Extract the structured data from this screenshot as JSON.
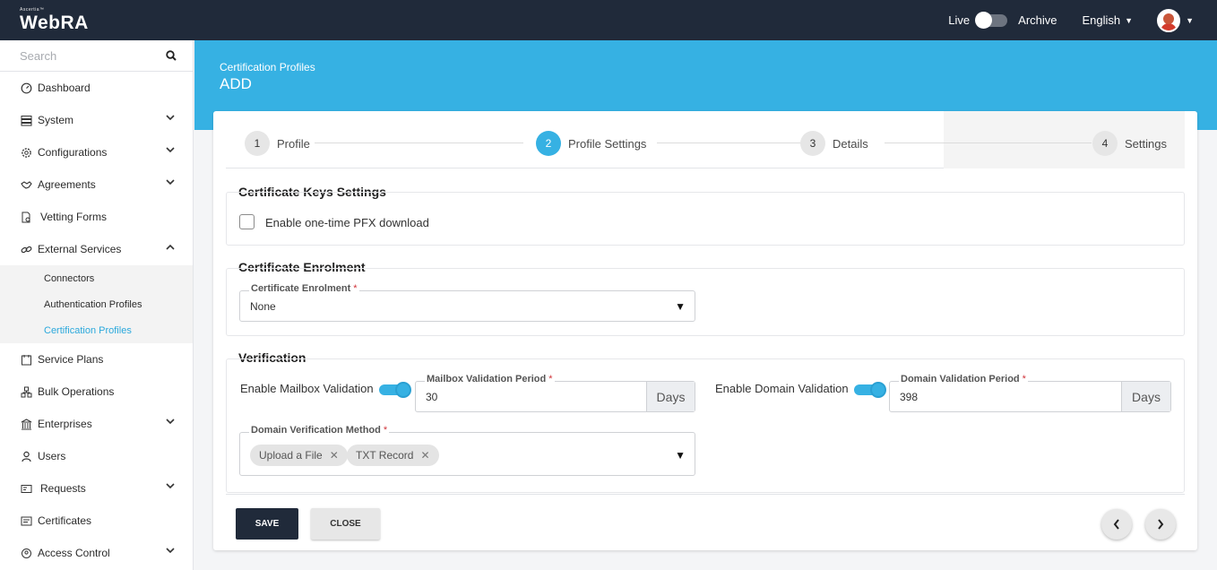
{
  "app": {
    "brand_small": "Ascertia™",
    "brand": "WebRA"
  },
  "topbar": {
    "live_label": "Live",
    "archive_label": "Archive",
    "language": "English"
  },
  "sidebar": {
    "search_placeholder": "Search",
    "items": [
      {
        "label": "Dashboard",
        "icon": "dashboard-icon",
        "expandable": false
      },
      {
        "label": "System",
        "icon": "system-icon",
        "expandable": true
      },
      {
        "label": "Configurations",
        "icon": "gear-icon",
        "expandable": true
      },
      {
        "label": "Agreements",
        "icon": "handshake-icon",
        "expandable": true
      },
      {
        "label": "Vetting Forms",
        "icon": "vetting-forms-icon",
        "expandable": false
      },
      {
        "label": "External Services",
        "icon": "link-icon",
        "expandable": true,
        "expanded": true
      },
      {
        "label": "Service Plans",
        "icon": "service-plans-icon",
        "expandable": false
      },
      {
        "label": "Bulk Operations",
        "icon": "bulk-operations-icon",
        "expandable": false
      },
      {
        "label": "Enterprises",
        "icon": "enterprise-icon",
        "expandable": true
      },
      {
        "label": "Users",
        "icon": "user-icon",
        "expandable": false
      },
      {
        "label": "Requests",
        "icon": "requests-icon",
        "expandable": true
      },
      {
        "label": "Certificates",
        "icon": "certificate-icon",
        "expandable": false
      },
      {
        "label": "Access Control",
        "icon": "access-control-icon",
        "expandable": true
      }
    ],
    "sub_items": [
      "Connectors",
      "Authentication Profiles",
      "Certification Profiles"
    ],
    "active_sub": "Certification Profiles"
  },
  "header": {
    "breadcrumb": "Certification Profiles",
    "title": "ADD"
  },
  "steps": [
    {
      "num": "1",
      "label": "Profile"
    },
    {
      "num": "2",
      "label": "Profile Settings",
      "active": true
    },
    {
      "num": "3",
      "label": "Details"
    },
    {
      "num": "4",
      "label": "Settings"
    }
  ],
  "keys": {
    "title": "Certificate Keys Settings",
    "pfx_label": "Enable one-time PFX download",
    "pfx_checked": false
  },
  "enrolment": {
    "title": "Certificate Enrolment",
    "field_label": "Certificate Enrolment",
    "value": "None"
  },
  "verification": {
    "title": "Verification",
    "mailbox_toggle_label": "Enable Mailbox Validation",
    "mailbox_enabled": true,
    "mailbox_period_label": "Mailbox Validation Period",
    "mailbox_period_value": "30",
    "mailbox_unit": "Days",
    "domain_toggle_label": "Enable Domain Validation",
    "domain_enabled": true,
    "domain_period_label": "Domain Validation Period",
    "domain_period_value": "398",
    "domain_unit": "Days",
    "method_label": "Domain Verification Method",
    "methods": [
      "Upload a File",
      "TXT Record"
    ]
  },
  "footer": {
    "save_label": "SAVE",
    "close_label": "CLOSE"
  },
  "colors": {
    "accent": "#36b1e3",
    "topbar": "#202a3a",
    "required": "#d0343a"
  }
}
